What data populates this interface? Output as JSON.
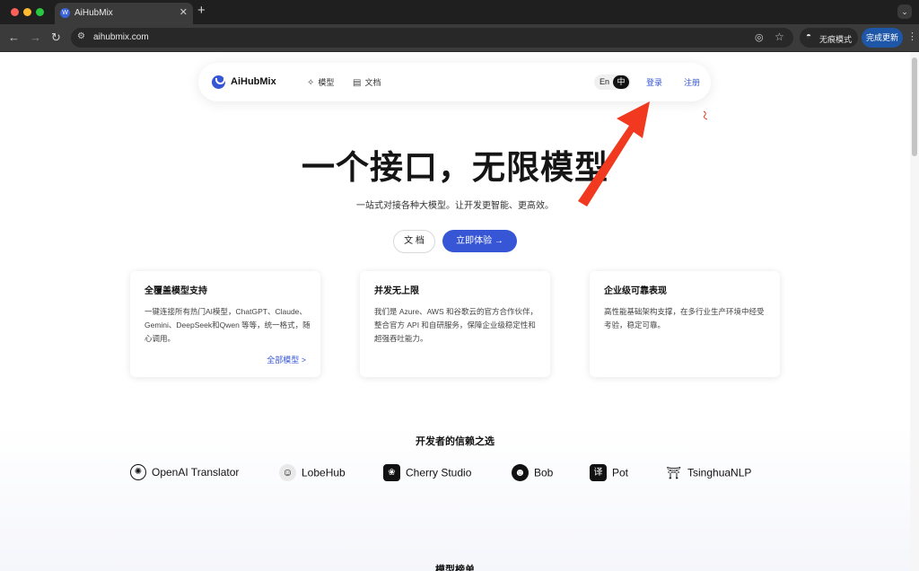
{
  "browser": {
    "tab_title": "AiHubMix",
    "tab_favicon": "W",
    "url": "aihubmix.com",
    "incognito_label": "无痕模式",
    "update_label": "完成更新"
  },
  "nav": {
    "brand": "AiHubMix",
    "models": "模型",
    "docs": "文档",
    "lang_en": "En",
    "lang_zh": "中",
    "login": "登录",
    "register": "注册"
  },
  "hero": {
    "title": "一个接口，无限模型",
    "subtitle": "一站式对接各种大模型。让开发更智能、更高效。",
    "btn_docs": "文 档",
    "btn_try": "立即体验 →"
  },
  "cards": [
    {
      "title": "全覆盖模型支持",
      "body": "一键连接所有热门AI模型，ChatGPT、Claude、Gemini、DeepSeek和Qwen 等等，统一格式，随心调用。",
      "link": "全部模型 >"
    },
    {
      "title": "并发无上限",
      "body": "我们是 Azure、AWS 和谷歌云的官方合作伙伴，整合官方 API 和自研服务，保障企业级稳定性和超强吞吐能力。"
    },
    {
      "title": "企业级可靠表现",
      "body": "高性能基础架构支撑，在多行业生产环境中经受考验，稳定可靠。"
    }
  ],
  "trust": {
    "heading": "开发者的信赖之选",
    "partners": [
      "OpenAI Translator",
      "LobeHub",
      "Cherry Studio",
      "Bob",
      "Pot",
      "TsinghuaNLP"
    ]
  },
  "ranking_heading": "模型榜单",
  "colors": {
    "accent": "#3656d6",
    "annotation_arrow": "#f0391f"
  }
}
